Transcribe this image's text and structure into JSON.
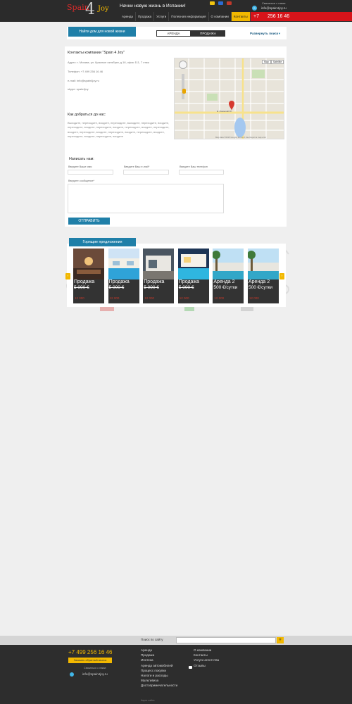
{
  "header": {
    "logo_text": [
      "Spain",
      "4",
      "Joy"
    ],
    "slogan": "Начни новую жизнь в Испании!",
    "flags": [
      {
        "name": "es-flag-icon",
        "color": "#f1c40f"
      },
      {
        "name": "ru-flag-icon",
        "color": "#2c6bd1"
      },
      {
        "name": "en-flag-icon",
        "color": "#c0392b"
      }
    ],
    "contact_caption": "Связаться с нами:",
    "email": "info@spain4joy.ru",
    "nav": [
      "Аренда",
      "Продажа",
      "Услуги",
      "Полезная информация",
      "О компании",
      "Контакты"
    ],
    "nav_active_index": 5,
    "phone_code": "+7",
    "phone_number": "256 16 46"
  },
  "search": {
    "find_button": "Найти дом для новой жизни",
    "rent_tab": "АРЕНДА",
    "sale_tab": "ПРОДАЖА",
    "expand_label": "Развернуть поиск",
    "expand_icon": "chevron-down-icon"
  },
  "contacts": {
    "title": "Контакты компании \"Spain 4 Joy\"",
    "address": "Адрес:   г. Москва, ул. Красные октябрят, д.16, офис 111, 7 этаж",
    "phone": "Телефон:  +7 499 256 16 46",
    "email": "e-mail:   info@spain4joy.ru",
    "skype": "skype:   spain4joy",
    "map": {
      "types": [
        "Map",
        "Satellite"
      ],
      "street_label": "E. Roosevelt Dr.",
      "copyright": "Map data ©2015 Google   Terms of Use   Report a map error"
    },
    "how_title": "Как добраться до нас:",
    "how_text": "Выходите, переходите, входите, переходите, выходите, переходите, входите, переходите, входите, переходите, входите, переходите, входите, переходите, входите, переходите, входите, переходите, входите, переходите, входите, переходите, входите, переходите, входите"
  },
  "form": {
    "title": "Написать нам:",
    "name_label": "Введите Ваше имя",
    "email_label": "Введите Ваш e-mail*",
    "phone_label": "Введите Ваш телефон",
    "message_label": "Введите сообщение*",
    "send_button": "ОТПРАВИТЬ"
  },
  "deals": {
    "tab_label": "Горящие предложения",
    "items": [
      {
        "type": "Продажа",
        "price": "5 000  €",
        "extra": "12 000",
        "strike": true,
        "img": "interior"
      },
      {
        "type": "Продажа",
        "price": "5 000  €",
        "extra": "12 000",
        "strike": true,
        "img": "pool-villa"
      },
      {
        "type": "Продажа",
        "price": "5 000  €",
        "extra": "12 000",
        "strike": true,
        "img": "modern-house"
      },
      {
        "type": "Продажа",
        "price": "5 000  €",
        "extra": "12 000",
        "strike": true,
        "img": "pool-night"
      },
      {
        "type": "Аренда 2",
        "price": "500  €/сутки",
        "extra": "12 000",
        "strike": false,
        "img": "palm-villa"
      },
      {
        "type": "Аренда 2",
        "price": "500  €/сутки",
        "extra": "12 000",
        "strike": false,
        "img": "palm-villa"
      }
    ]
  },
  "footer": {
    "search_label": "Поиск по сайту",
    "search_icon": "search-icon",
    "phone": "+7 499 256 16 46",
    "call_button": "Заказать обратный звонок",
    "contact_caption": "Связаться с нами:",
    "email": "info@spain4joy.ru",
    "col1": [
      "Аренда",
      "Продажа",
      "Ипотека",
      "Аренда автомобилей",
      "Процесс покупки",
      "Налоги и расходы",
      "Мультивиза",
      "Достопримечательности"
    ],
    "col2": [
      "О компании",
      "Контакты",
      "Услуги агентства",
      "Отзывы"
    ],
    "site_map": "Карта сайта"
  }
}
